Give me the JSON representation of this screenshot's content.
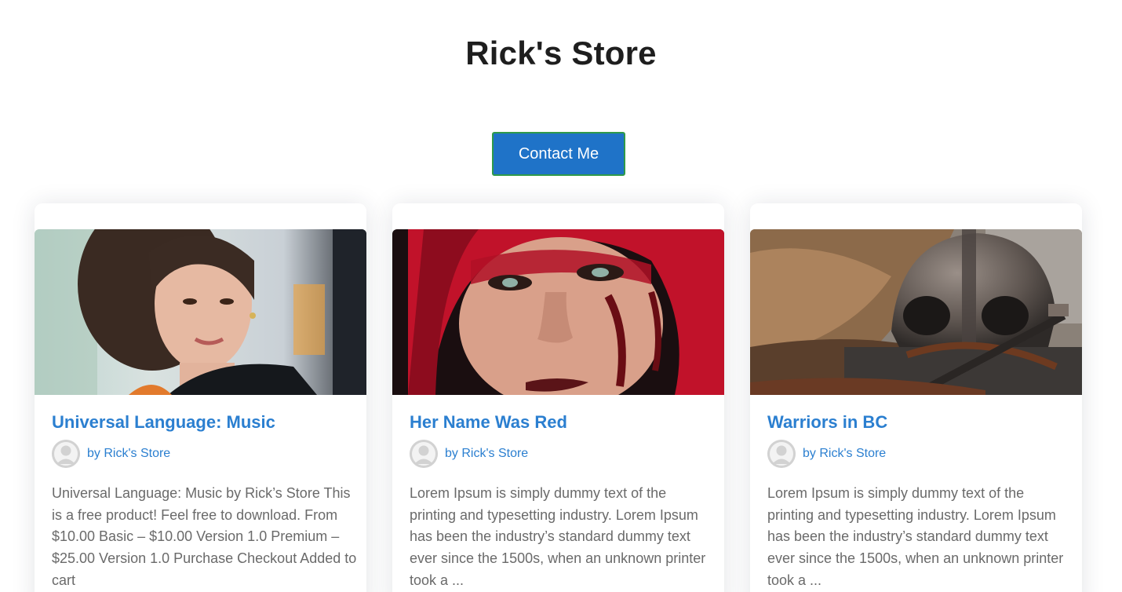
{
  "header": {
    "title": "Rick's Store",
    "contact_button": "Contact Me"
  },
  "colors": {
    "button_bg": "#1f73c8",
    "button_border": "#2f9a4a",
    "link": "#2b7fd0",
    "excerpt_text": "#6a6a6a"
  },
  "cards": [
    {
      "title": "Universal Language: Music",
      "author": "by Rick's Store",
      "image_icon": "portrait-woman-photo",
      "excerpt": "Universal Language: Music by Rick’s Store This is a free product! Feel free to download. From $10.00  Basic – $10.00 Version 1.0  Premium – $25.00 Version 1.0 Purchase Checkout Added to cart"
    },
    {
      "title": "Her Name Was Red",
      "author": "by Rick's Store",
      "image_icon": "red-hood-woman-photo",
      "excerpt": "Lorem Ipsum is simply dummy text of the printing and typesetting industry. Lorem Ipsum has been the industry’s standard dummy text ever since the 1500s, when an unknown printer took a ..."
    },
    {
      "title": "Warriors in BC",
      "author": "by Rick's Store",
      "image_icon": "viking-helmet-photo",
      "excerpt": "Lorem Ipsum is simply dummy text of the printing and typesetting industry. Lorem Ipsum has been the industry’s standard dummy text ever since the 1500s, when an unknown printer took a ..."
    }
  ]
}
